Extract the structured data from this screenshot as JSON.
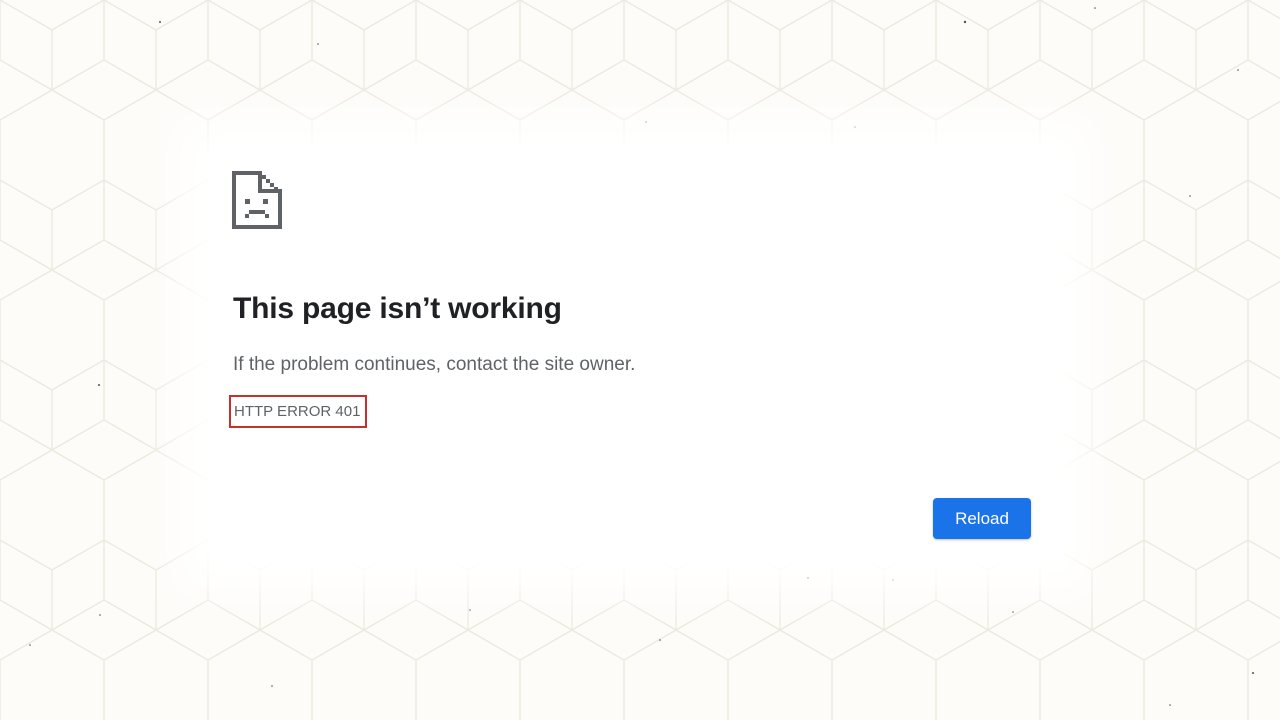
{
  "error_page": {
    "icon": "sad-document-icon",
    "title": "This page isn’t working",
    "message": "If the problem continues, contact the site owner.",
    "error_code": "HTTP ERROR 401",
    "reload_label": "Reload"
  },
  "colors": {
    "accent": "#1a73e8",
    "title_text": "#202124",
    "body_text": "#5f6368",
    "highlight_border": "#c9302c",
    "background": "#fdfcf9"
  }
}
